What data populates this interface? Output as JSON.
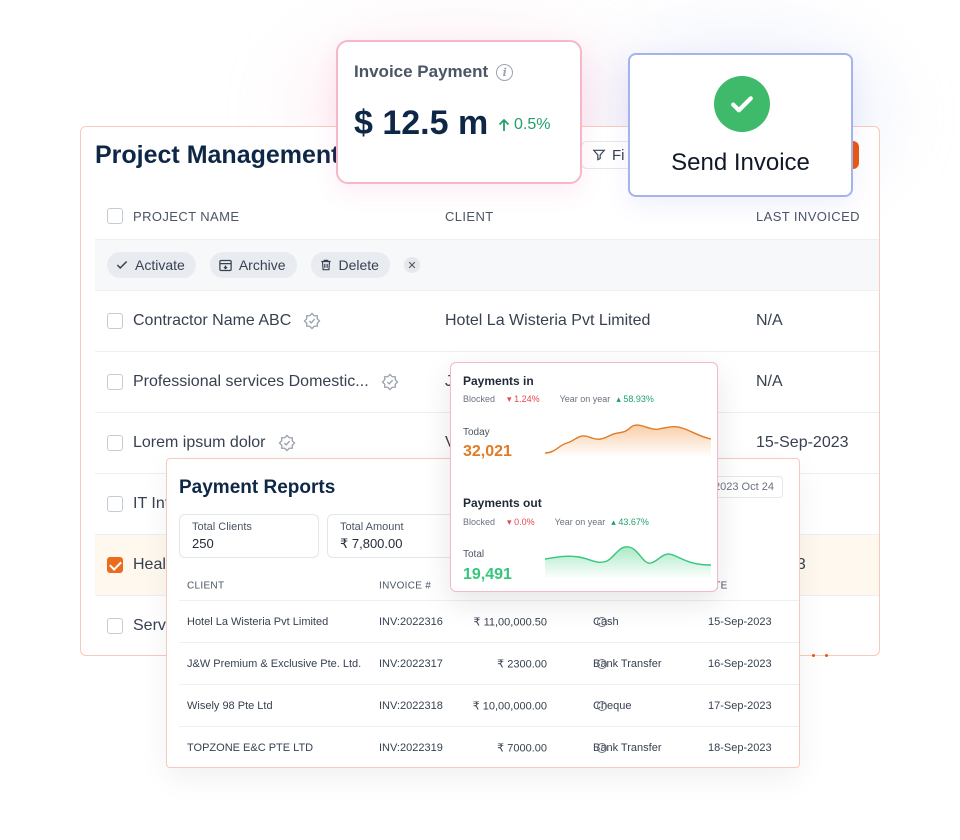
{
  "project_management": {
    "title": "Project Management",
    "filter_label": "Fi",
    "columns": {
      "project_name": "PROJECT NAME",
      "client": "CLIENT",
      "last_invoiced": "LAST INVOICED"
    },
    "actions": {
      "activate": "Activate",
      "archive": "Archive",
      "delete": "Delete"
    },
    "rows": [
      {
        "name": "Contractor Name ABC",
        "client": "Hotel La Wisteria Pvt Limited",
        "last": "N/A",
        "selected": false
      },
      {
        "name": "Professional services Domestic...",
        "client": "J",
        "last": "N/A",
        "selected": false
      },
      {
        "name": "Lorem ipsum dolor",
        "client": "V",
        "last": "15-Sep-2023",
        "selected": false
      },
      {
        "name": "IT Int",
        "client": "",
        "last": "",
        "selected": false
      },
      {
        "name": "Heal",
        "client": "",
        "last": "p-2023",
        "selected": true
      },
      {
        "name": "Serv",
        "client": "",
        "last": "",
        "selected": false
      }
    ]
  },
  "invoice_payment": {
    "label": "Invoice Payment",
    "amount": "$ 12.5 m",
    "change": "0.5%"
  },
  "send_invoice": {
    "label": "Send Invoice"
  },
  "payment_reports": {
    "title": "Payment Reports",
    "date_range": "2023 Oct 24",
    "stats": [
      {
        "label": "Total Clients",
        "value": "250"
      },
      {
        "label": "Total Amount",
        "value": "₹ 7,800.00"
      }
    ],
    "columns": {
      "client": "CLIENT",
      "invoice": "INVOICE #",
      "date": "ATE"
    },
    "rows": [
      {
        "client": "Hotel La Wisteria Pvt Limited",
        "invoice": "INV:2022316",
        "amount": "₹ 11,00,000.50",
        "method": "Cash",
        "date": "15-Sep-2023"
      },
      {
        "client": "J&W Premium & Exclusive Pte. Ltd.",
        "invoice": "INV:2022317",
        "amount": "₹ 2300.00",
        "method": "Bank Transfer",
        "date": "16-Sep-2023"
      },
      {
        "client": "Wisely 98 Pte Ltd",
        "invoice": "INV:2022318",
        "amount": "₹ 10,00,000.00",
        "method": "Cheque",
        "date": "17-Sep-2023"
      },
      {
        "client": "TOPZONE E&C PTE LTD",
        "invoice": "INV:2022319",
        "amount": "₹ 7000.00",
        "method": "Bank Transfer",
        "date": "18-Sep-2023"
      }
    ]
  },
  "payments": {
    "in": {
      "title": "Payments in",
      "blocked_label": "Blocked",
      "blocked_change": "1.24%",
      "yoy_label": "Year on year",
      "yoy_change": "58.93%",
      "sub_label": "Today",
      "value": "32,021",
      "color": "#e07b26"
    },
    "out": {
      "title": "Payments out",
      "blocked_label": "Blocked",
      "blocked_change": "0.0%",
      "yoy_label": "Year on year",
      "yoy_change": "43.67%",
      "sub_label": "Total",
      "value": "19,491",
      "color": "#34c77b"
    }
  },
  "colors": {
    "brand_navy": "#0f2747",
    "accent_orange": "#ea580c",
    "success_green": "#3fb96a"
  }
}
